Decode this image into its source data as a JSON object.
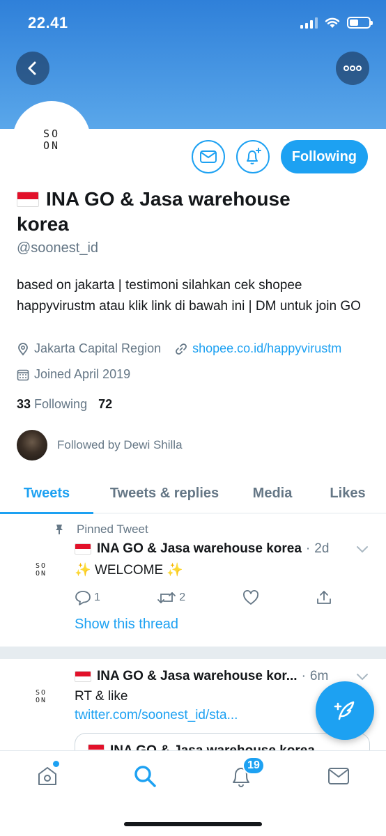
{
  "status_bar": {
    "time": "22.41"
  },
  "colors": {
    "accent": "#1da1f2",
    "header_gradient_top": "#2f80d9",
    "header_gradient_bottom": "#5aa7ea",
    "secondary_text": "#657786"
  },
  "header": {
    "back_icon": "chevron-left-icon",
    "more_icon": "ellipsis-icon"
  },
  "profile": {
    "avatar_logo_line1": "SO",
    "avatar_logo_line2": "ON",
    "name": "INA GO & Jasa warehouse korea",
    "handle": "@soonest_id",
    "bio": "based on jakarta | testimoni silahkan cek shopee happyvirustm atau klik link di bawah ini | DM untuk join GO",
    "location": "Jakarta Capital Region",
    "website": "shopee.co.id/happyvirustm",
    "joined": "Joined April 2019",
    "following_count": "33",
    "following_label": "Following",
    "followers_count": "72",
    "followed_by": "Followed by Dewi Shilla"
  },
  "actions": {
    "following_label": "Following"
  },
  "tabs": [
    {
      "label": "Tweets",
      "active": true
    },
    {
      "label": "Tweets & replies",
      "active": false
    },
    {
      "label": "Media",
      "active": false
    },
    {
      "label": "Likes",
      "active": false
    }
  ],
  "tweets": [
    {
      "pinned_label": "Pinned Tweet",
      "author": "INA GO & Jasa warehouse korea",
      "dot": "·",
      "time": "2d",
      "text_sparkle_left": "✨",
      "text": "WELCOME",
      "text_sparkle_right": "✨",
      "reply_count": "1",
      "retweet_count": "2",
      "show_thread": "Show this thread"
    },
    {
      "author": "INA GO & Jasa warehouse kor...",
      "dot": "·",
      "time": "6m",
      "text": "RT & like",
      "link": "twitter.com/soonest_id/sta...",
      "quote_author": "INA GO & Jasa warehouse korea"
    }
  ],
  "bottom_nav": {
    "notifications_badge": "19"
  }
}
